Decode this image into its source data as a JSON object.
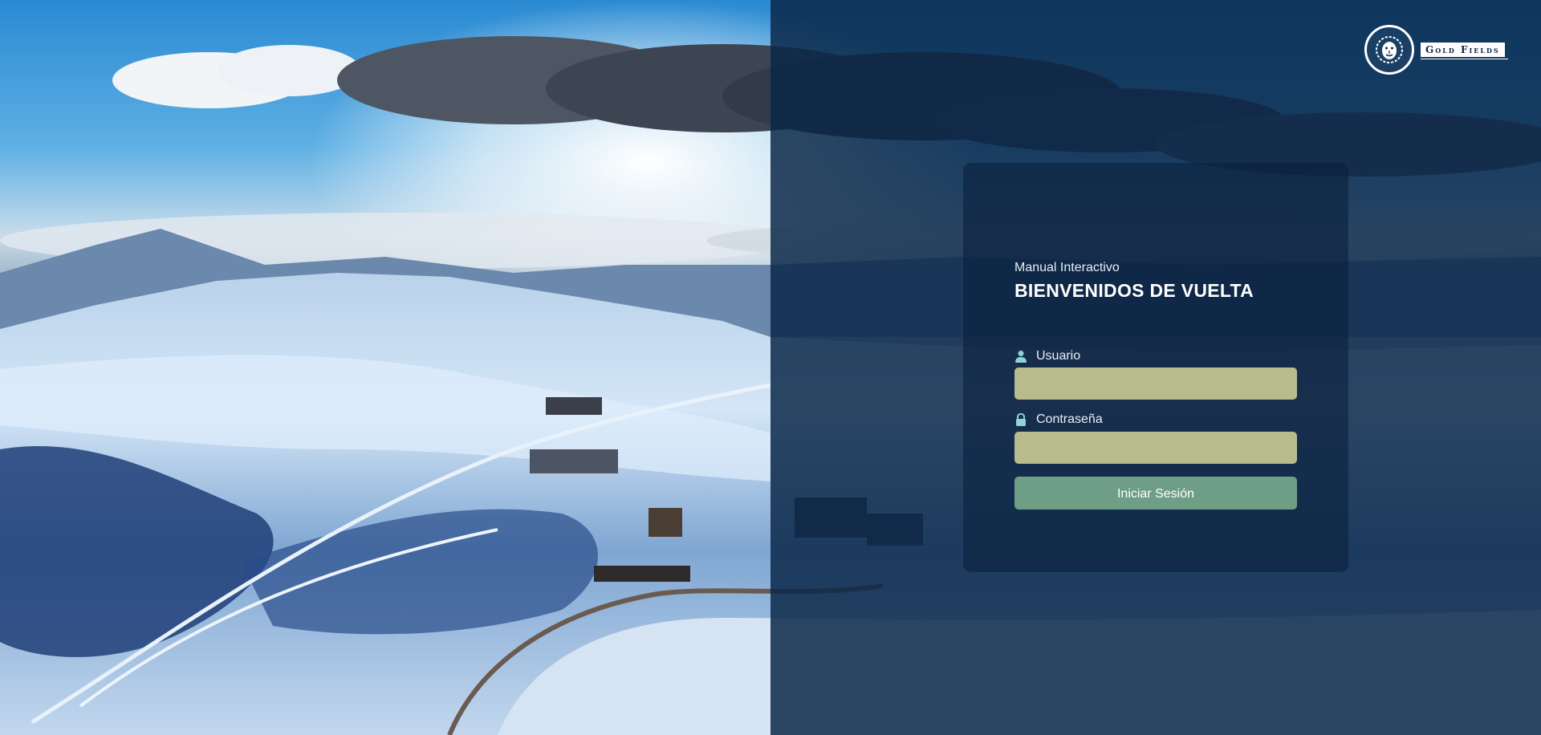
{
  "brand": {
    "name": "Gold Fields",
    "emblem_icon": "lion-head-icon"
  },
  "login": {
    "subtitle": "Manual Interactivo",
    "title": "BIENVENIDOS DE VUELTA",
    "username_label": "Usuario",
    "username_icon": "user-icon",
    "username_value": "",
    "password_label": "Contraseña",
    "password_icon": "lock-icon",
    "password_value": "",
    "submit_label": "Iniciar Sesión"
  },
  "colors": {
    "overlay": "#0a2648",
    "input_bg": "#b6bc8b",
    "button_bg": "#6f9e86",
    "icon_accent": "#8fd3d6"
  }
}
